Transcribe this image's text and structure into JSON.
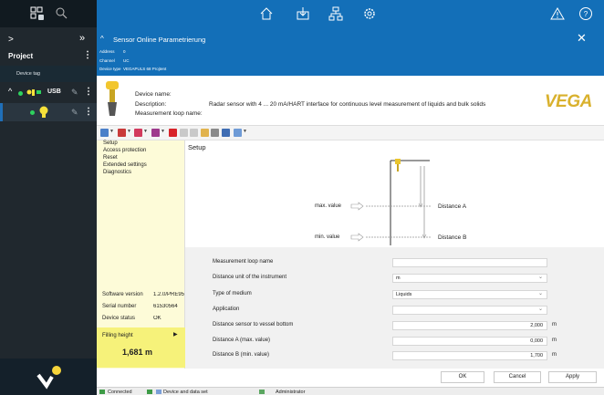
{
  "sidebar": {
    "project_label": "Project",
    "device_tag_label": "Device tag",
    "usb_label": "USB",
    "icons": [
      "grid-icon",
      "search-icon",
      "chevron-right-icon",
      "double-chevron-icon",
      "more-icon",
      "edit-icon",
      "logo-icon"
    ]
  },
  "header": {
    "icons": [
      "home-icon",
      "import-icon",
      "network-icon",
      "settings-icon",
      "warning-icon",
      "help-icon"
    ]
  },
  "panel": {
    "title": "Sensor Online Parametrierung",
    "address_label": "Address",
    "address_value": "0",
    "channel_label": "Channel",
    "channel_value": "UC",
    "devtype_label": "Device type",
    "devtype_value": "VEGAPULS 68 Projtent"
  },
  "device": {
    "name_label": "Device name:",
    "description_label": "Description:",
    "loop_label": "Measurement loop name:",
    "description_value": "Radar sensor with 4 ... 20 mA/HART interface for continuous level measurement of liquids and bulk solids",
    "brand": "VEGA"
  },
  "tree": {
    "items": [
      "Setup",
      "Access protection",
      "Reset",
      "Extended settings",
      "Diagnostics"
    ]
  },
  "side_info": {
    "software_label": "Software version",
    "software_value": "1.2.0/PRE95",
    "serial_label": "Serial number",
    "serial_value": "61530564",
    "status_label": "Device status",
    "status_value": "OK",
    "filling_label": "Filling height",
    "filling_value": "1,681 m"
  },
  "setup": {
    "title": "Setup",
    "max_label": "max. value",
    "min_label": "min. value",
    "distance_a": "Distance A",
    "distance_b": "Distance B"
  },
  "params": [
    {
      "label": "Measurement loop name",
      "value": "",
      "type": "text",
      "unit": ""
    },
    {
      "label": "Distance unit of the instrument",
      "value": "m",
      "type": "select",
      "unit": ""
    },
    {
      "label": "Type of medium",
      "value": "Liquids",
      "type": "select",
      "unit": ""
    },
    {
      "label": "Application",
      "value": "",
      "type": "select",
      "unit": ""
    },
    {
      "label": "Distance sensor to vessel bottom",
      "value": "2,000",
      "type": "number",
      "unit": "m"
    },
    {
      "label": "Distance A (max. value)",
      "value": "0,000",
      "type": "number",
      "unit": "m"
    },
    {
      "label": "Distance B (min. value)",
      "value": "1,700",
      "type": "number",
      "unit": "m"
    }
  ],
  "buttons": {
    "ok": "OK",
    "cancel": "Cancel",
    "apply": "Apply"
  },
  "statusbar": {
    "connected": "Connected",
    "device_dataset": "Device and data set",
    "user": "Administrator"
  },
  "colors": {
    "accent": "#136fb8",
    "sidebar": "#20282e",
    "tree_bg": "#fdfbd8",
    "filling_bg": "#f6f27a",
    "brand": "#d9b12d",
    "status_green": "#2ed25e"
  }
}
